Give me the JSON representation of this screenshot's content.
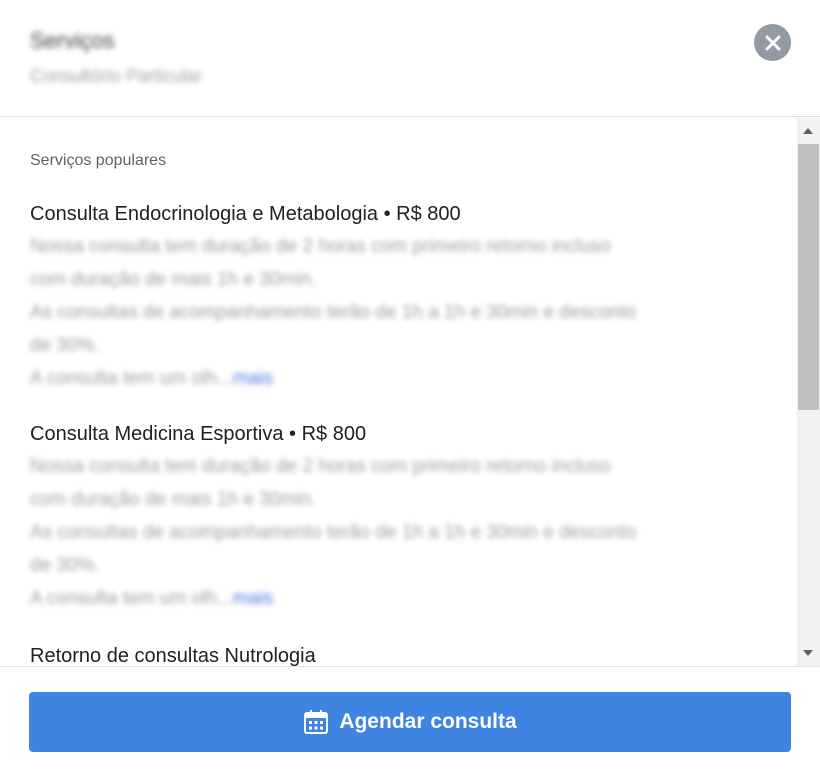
{
  "header": {
    "title": "Serviços",
    "subtitle": "Consultório Particular"
  },
  "icons": {
    "close": "close-icon",
    "calendar": "calendar-icon"
  },
  "section_label": "Serviços populares",
  "services": [
    {
      "name": "Consulta Endocrinologia e Metabologia • R$ 800",
      "desc_lines": [
        "Nossa consulta tem duração de 2 horas com primeiro retorno incluso",
        "com duração de mais 1h e 30min.",
        "As consultas de acompanhamento terão de 1h a 1h e 30min e desconto",
        "de 30%.",
        "A consulta tem um olh..."
      ],
      "more": "mais"
    },
    {
      "name": "Consulta Medicina Esportiva • R$ 800",
      "desc_lines": [
        "Nossa consulta tem duração de 2 horas com primeiro retorno incluso",
        "com duração de mais 1h e 30min.",
        "As consultas de acompanhamento terão de 1h a 1h e 30min e desconto",
        "de 30%.",
        "A consulta tem um olh..."
      ],
      "more": "mais"
    },
    {
      "name": "Retorno de consultas Nutrologia"
    }
  ],
  "cta": {
    "label": "Agendar consulta"
  },
  "colors": {
    "primary": "#3f84e0",
    "link": "#4a7ee0",
    "close_bg": "#939aa3"
  }
}
